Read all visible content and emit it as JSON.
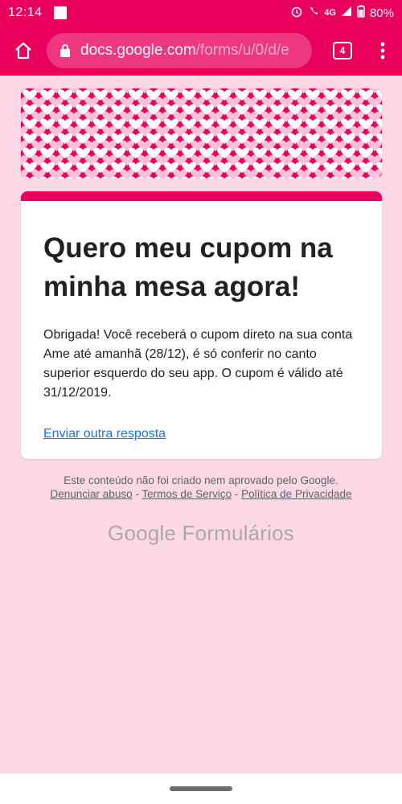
{
  "status": {
    "time": "12:14",
    "network": "4G",
    "battery": "80%"
  },
  "browser": {
    "url_domain": "docs.google.com",
    "url_path": "/forms/u/0/d/e",
    "tab_count": "4"
  },
  "form": {
    "title": "Quero meu cupom na minha mesa agora!",
    "message": "Obrigada! Você receberá o cupom direto na sua conta Ame até amanhã (28/12), é só conferir no canto superior esquerdo do seu app. O cupom é válido até 31/12/2019.",
    "resubmit_link": "Enviar outra resposta"
  },
  "footer": {
    "disclaimer": "Este conteúdo não foi criado nem aprovado pelo Google.",
    "report_abuse": "Denunciar abuso",
    "terms": "Termos de Serviço",
    "privacy": "Política de Privacidade",
    "separator": " - "
  },
  "brand": {
    "google": "Google",
    "product": "Formulários"
  },
  "colors": {
    "accent": "#e8005c",
    "background": "#fcd8e4",
    "link": "#1a73e8"
  }
}
